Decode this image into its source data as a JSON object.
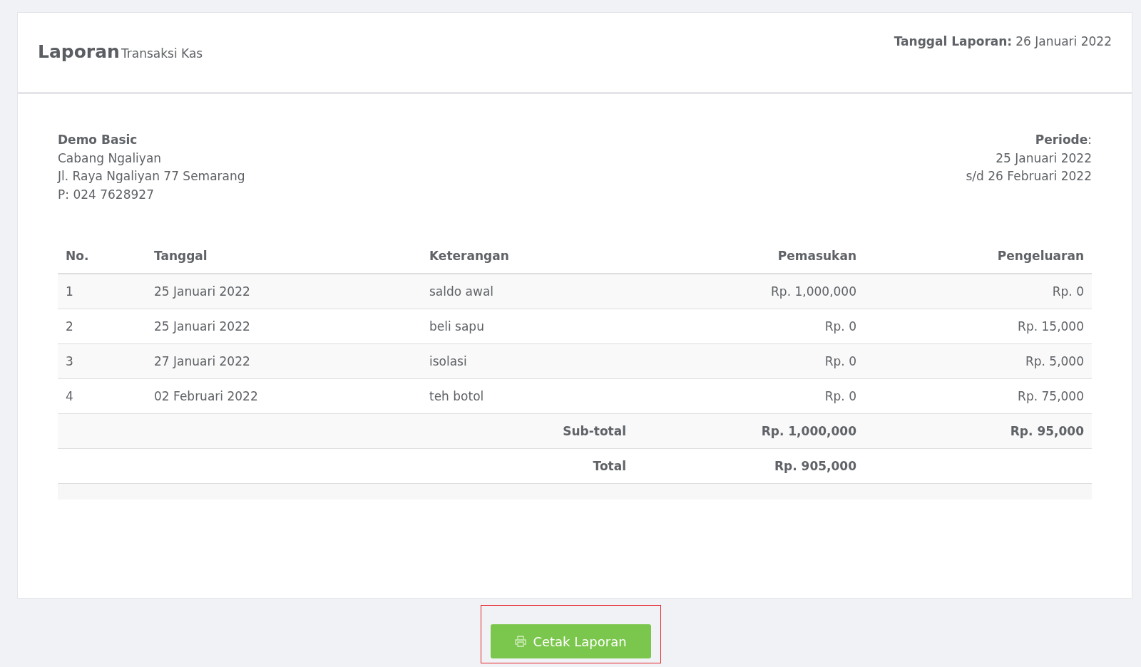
{
  "header": {
    "title": "Laporan",
    "subtitle": "Transaksi Kas",
    "report_date_label": "Tanggal Laporan:",
    "report_date": "26 Januari 2022"
  },
  "company": {
    "name": "Demo Basic",
    "lines": [
      "Cabang Ngaliyan",
      "Jl. Raya Ngaliyan 77 Semarang",
      "P: 024 7628927"
    ]
  },
  "period": {
    "label": "Periode",
    "colon": ":",
    "lines": [
      "25 Januari 2022",
      "s/d 26 Februari 2022"
    ]
  },
  "table": {
    "columns": [
      "No.",
      "Tanggal",
      "Keterangan",
      "Pemasukan",
      "Pengeluaran"
    ],
    "rows": [
      {
        "no": "1",
        "date": "25 Januari 2022",
        "description": "saldo awal",
        "income": "Rp. 1,000,000",
        "expense": "Rp. 0"
      },
      {
        "no": "2",
        "date": "25 Januari 2022",
        "description": "beli sapu",
        "income": "Rp. 0",
        "expense": "Rp. 15,000"
      },
      {
        "no": "3",
        "date": "27 Januari 2022",
        "description": "isolasi",
        "income": "Rp. 0",
        "expense": "Rp. 5,000"
      },
      {
        "no": "4",
        "date": "02 Februari 2022",
        "description": "teh botol",
        "income": "Rp. 0",
        "expense": "Rp. 75,000"
      }
    ],
    "subtotal": {
      "label": "Sub-total",
      "income": "Rp. 1,000,000",
      "expense": "Rp. 95,000"
    },
    "total": {
      "label": "Total",
      "income": "Rp. 905,000"
    }
  },
  "print_button": {
    "label": "Cetak Laporan",
    "highlighted": true
  }
}
